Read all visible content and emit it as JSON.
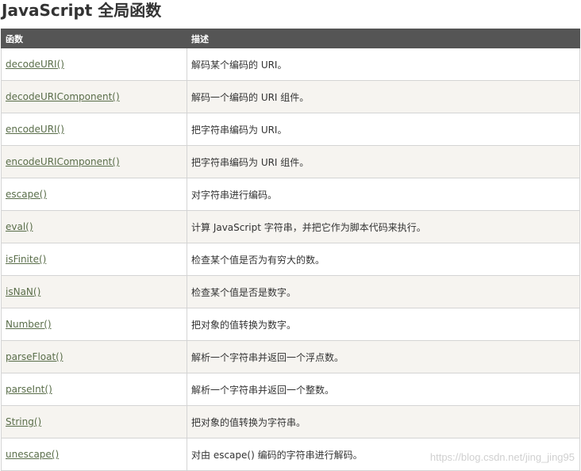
{
  "page": {
    "title": "JavaScript 全局函数"
  },
  "table": {
    "headers": {
      "function": "函数",
      "description": "描述"
    },
    "rows": [
      {
        "function": "decodeURI()",
        "description": "解码某个编码的 URI。"
      },
      {
        "function": "decodeURIComponent()",
        "description": "解码一个编码的 URI 组件。"
      },
      {
        "function": "encodeURI()",
        "description": "把字符串编码为 URI。"
      },
      {
        "function": "encodeURIComponent()",
        "description": "把字符串编码为 URI 组件。"
      },
      {
        "function": "escape()",
        "description": "对字符串进行编码。"
      },
      {
        "function": "eval()",
        "description": "计算 JavaScript 字符串，并把它作为脚本代码来执行。"
      },
      {
        "function": "isFinite()",
        "description": "检查某个值是否为有穷大的数。"
      },
      {
        "function": "isNaN()",
        "description": "检查某个值是否是数字。"
      },
      {
        "function": "Number()",
        "description": "把对象的值转换为数字。"
      },
      {
        "function": "parseFloat()",
        "description": "解析一个字符串并返回一个浮点数。"
      },
      {
        "function": "parseInt()",
        "description": "解析一个字符串并返回一个整数。"
      },
      {
        "function": "String()",
        "description": "把对象的值转换为字符串。"
      },
      {
        "function": "unescape()",
        "description": "对由 escape() 编码的字符串进行解码。"
      }
    ]
  },
  "watermark": {
    "text": "https://blog.csdn.net/jing_jing95"
  },
  "colors": {
    "header_bg": "#555555",
    "link": "#5a6e4a",
    "stripe": "#f6f4f0"
  }
}
